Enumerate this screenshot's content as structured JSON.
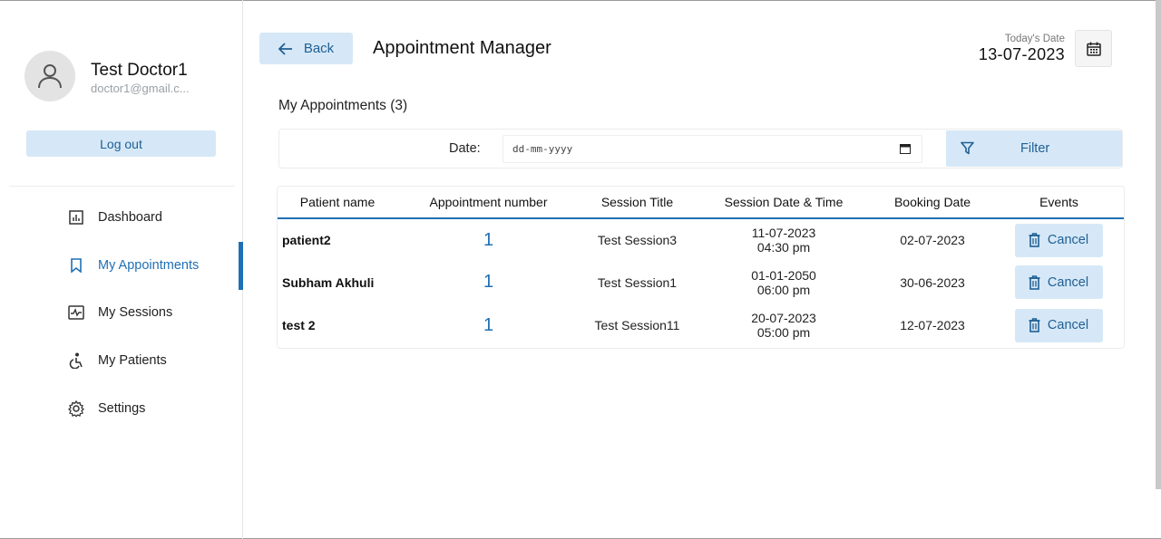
{
  "user": {
    "name": "Test Doctor1",
    "email": "doctor1@gmail.c...",
    "logout_label": "Log out"
  },
  "nav": {
    "items": [
      {
        "label": "Dashboard",
        "icon": "dashboard-icon",
        "active": false
      },
      {
        "label": "My Appointments",
        "icon": "bookmark-icon",
        "active": true
      },
      {
        "label": "My Sessions",
        "icon": "sessions-icon",
        "active": false
      },
      {
        "label": "My Patients",
        "icon": "patients-icon",
        "active": false
      },
      {
        "label": "Settings",
        "icon": "gear-icon",
        "active": false
      }
    ]
  },
  "header": {
    "back_label": "Back",
    "title": "Appointment Manager",
    "today_label": "Today's Date",
    "today_value": "13-07-2023"
  },
  "section": {
    "title": "My Appointments (3)"
  },
  "filter": {
    "date_label": "Date:",
    "date_placeholder": "dd-mm-yyyy",
    "button_label": "Filter"
  },
  "table": {
    "headers": [
      "Patient name",
      "Appointment number",
      "Session Title",
      "Session Date & Time",
      "Booking Date",
      "Events"
    ],
    "rows": [
      {
        "patient": "patient2",
        "number": "1",
        "session": "Test Session3",
        "date": "11-07-2023",
        "time": "04:30 pm",
        "booking": "02-07-2023",
        "action": "Cancel"
      },
      {
        "patient": "Subham Akhuli",
        "number": "1",
        "session": "Test Session1",
        "date": "01-01-2050",
        "time": "06:00 pm",
        "booking": "30-06-2023",
        "action": "Cancel"
      },
      {
        "patient": "test 2",
        "number": "1",
        "session": "Test Session11",
        "date": "20-07-2023",
        "time": "05:00 pm",
        "booking": "12-07-2023",
        "action": "Cancel"
      }
    ]
  },
  "colors": {
    "accent": "#1f6fb5",
    "button_bg": "#d6e8f7",
    "button_text": "#1f5f94"
  }
}
